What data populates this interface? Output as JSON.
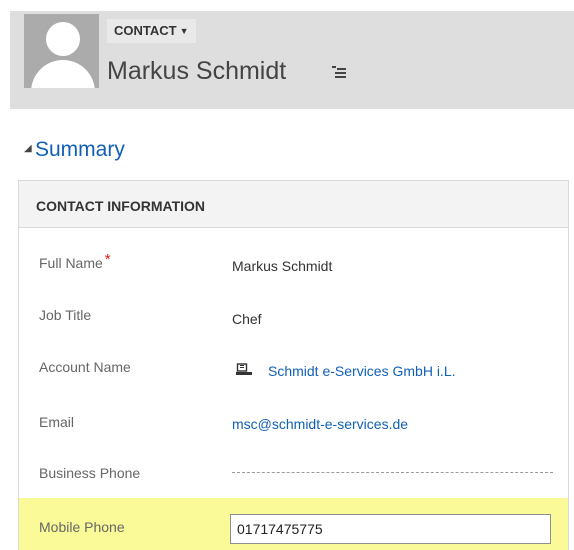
{
  "header": {
    "entity_type": "CONTACT",
    "record_name": "Markus Schmidt"
  },
  "section": {
    "title": "Summary",
    "panel_title": "CONTACT INFORMATION"
  },
  "fields": {
    "full_name": {
      "label": "Full Name",
      "required_mark": "*",
      "value": "Markus Schmidt"
    },
    "job_title": {
      "label": "Job Title",
      "value": "Chef"
    },
    "account_name": {
      "label": "Account Name",
      "value": "Schmidt e-Services GmbH i.L."
    },
    "email": {
      "label": "Email",
      "value": "msc@schmidt-e-services.de"
    },
    "business_phone": {
      "label": "Business Phone",
      "value": ""
    },
    "mobile_phone": {
      "label": "Mobile Phone",
      "value": "01717475775"
    }
  },
  "colors": {
    "link": "#1160b7",
    "required": "#d81b1b",
    "highlight": "#fafa98",
    "header_bg": "#dedede"
  },
  "icons": {
    "avatar": "person-silhouette-icon",
    "entity_menu": "caret-down-icon",
    "record_menu": "menu-list-icon",
    "section_toggle": "collapse-triangle-icon",
    "account_lookup": "account-lookup-icon"
  }
}
